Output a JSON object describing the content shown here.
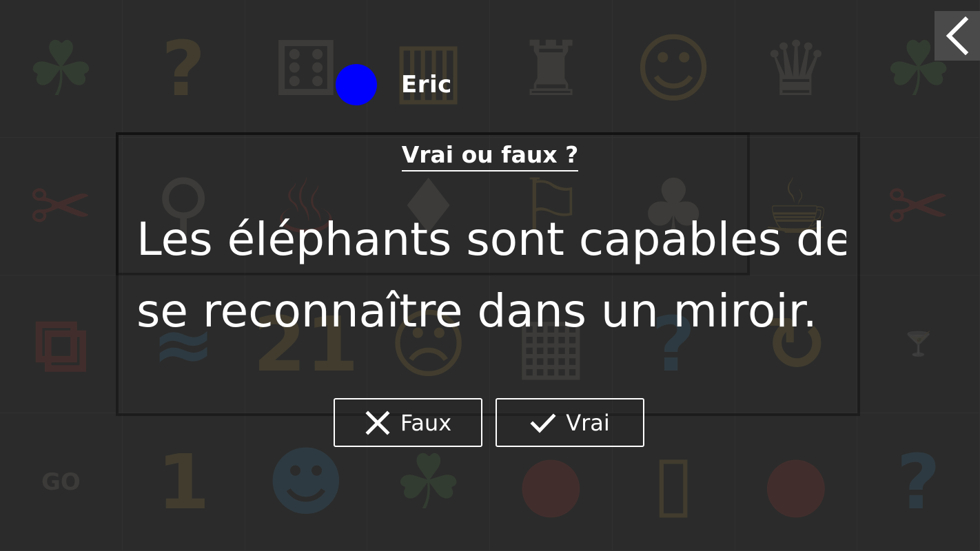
{
  "board": {
    "tiles": [
      {
        "glyph": "☘",
        "tone": "green"
      },
      {
        "glyph": "?",
        "tone": "yellow"
      },
      {
        "glyph": "⚅",
        "tone": "plain"
      },
      {
        "glyph": "▥",
        "tone": "yellow"
      },
      {
        "glyph": "♜",
        "tone": "plain"
      },
      {
        "glyph": "☺",
        "tone": "yellow"
      },
      {
        "glyph": "♛",
        "tone": "plain"
      },
      {
        "glyph": "☘",
        "tone": "green"
      },
      {
        "glyph": "✂",
        "tone": "red"
      },
      {
        "glyph": "⚲",
        "tone": "plain"
      },
      {
        "glyph": "♨",
        "tone": "red"
      },
      {
        "glyph": "♦",
        "tone": "plain"
      },
      {
        "glyph": "⚐",
        "tone": "yellow"
      },
      {
        "glyph": "♣",
        "tone": "plain"
      },
      {
        "glyph": "☕",
        "tone": "yellow"
      },
      {
        "glyph": "✂",
        "tone": "red"
      },
      {
        "glyph": "⧉",
        "tone": "red"
      },
      {
        "glyph": "≈",
        "tone": "blue"
      },
      {
        "glyph": "21",
        "tone": "yellow"
      },
      {
        "glyph": "☹",
        "tone": "yellow"
      },
      {
        "glyph": "▦",
        "tone": "plain"
      },
      {
        "glyph": "?",
        "tone": "blue"
      },
      {
        "glyph": "↻",
        "tone": "yellow"
      },
      {
        "glyph": "🍸",
        "tone": "red"
      },
      {
        "glyph": "GO",
        "tone": "plain"
      },
      {
        "glyph": "1",
        "tone": "yellow"
      },
      {
        "glyph": "☻",
        "tone": "blue"
      },
      {
        "glyph": "☘",
        "tone": "green"
      },
      {
        "glyph": "●",
        "tone": "red"
      },
      {
        "glyph": "▯",
        "tone": "yellow"
      },
      {
        "glyph": "●",
        "tone": "red"
      },
      {
        "glyph": "?",
        "tone": "blue"
      }
    ]
  },
  "back_button": {
    "icon": "chevron-left-icon"
  },
  "player": {
    "name": "Eric",
    "color": "#0000ff"
  },
  "question": {
    "type_label": "Vrai ou faux ?",
    "line1": "Les éléphants sont capables de",
    "line2": "se reconnaître dans un miroir."
  },
  "answers": {
    "false_label": "Faux",
    "false_icon": "close-icon",
    "true_label": "Vrai",
    "true_icon": "check-icon"
  }
}
